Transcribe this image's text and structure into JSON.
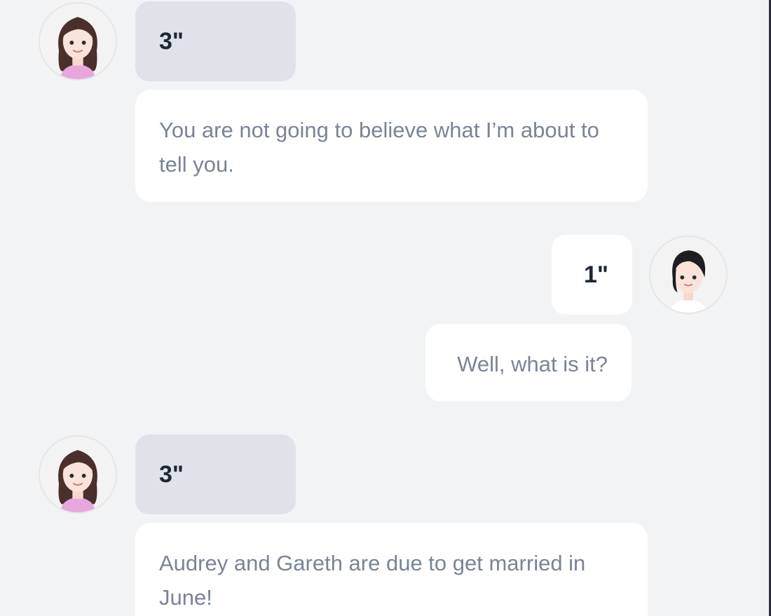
{
  "messages": [
    {
      "sender": "contact",
      "avatar": "female-long-hair-avatar-icon",
      "duration": "3\"",
      "text": "You are not going to believe what I’m about to tell you."
    },
    {
      "sender": "self",
      "avatar": "female-short-hair-avatar-icon",
      "duration": "1\"",
      "text": "Well, what is it?"
    },
    {
      "sender": "contact",
      "avatar": "female-long-hair-avatar-icon",
      "duration": "3\"",
      "text": "Audrey and Gareth are due to get married in June!"
    }
  ],
  "colors": {
    "background": "#f2f3f5",
    "duration_bubble_contact": "#dfe3e9",
    "message_bubble": "#ffffff",
    "message_text": "#7a8497",
    "duration_text": "#1f2636"
  }
}
